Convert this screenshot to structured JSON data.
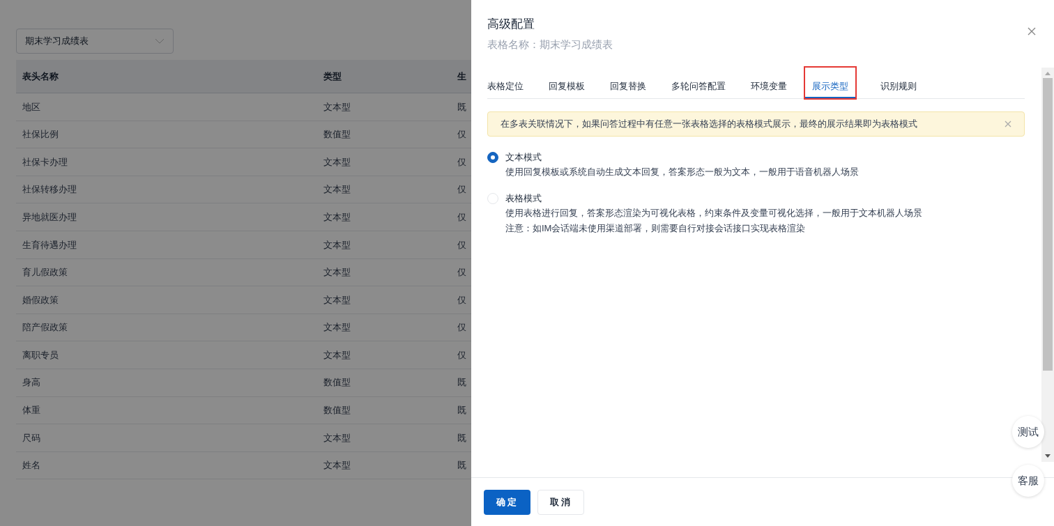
{
  "background": {
    "select": {
      "value": "期末学习成绩表"
    },
    "table": {
      "columns": [
        "表头名称",
        "类型",
        "生"
      ],
      "rows": [
        [
          "地区",
          "文本型",
          "既"
        ],
        [
          "社保比例",
          "数值型",
          "仅"
        ],
        [
          "社保卡办理",
          "文本型",
          "仅"
        ],
        [
          "社保转移办理",
          "文本型",
          "仅"
        ],
        [
          "异地就医办理",
          "文本型",
          "仅"
        ],
        [
          "生育待遇办理",
          "文本型",
          "仅"
        ],
        [
          "育儿假政策",
          "文本型",
          "仅"
        ],
        [
          "婚假政策",
          "文本型",
          "仅"
        ],
        [
          "陪产假政策",
          "文本型",
          "仅"
        ],
        [
          "离职专员",
          "文本型",
          "仅"
        ],
        [
          "身高",
          "数值型",
          "既"
        ],
        [
          "体重",
          "数值型",
          "既"
        ],
        [
          "尺码",
          "文本型",
          "既"
        ],
        [
          "姓名",
          "文本型",
          "既"
        ]
      ]
    }
  },
  "drawer": {
    "title": "高级配置",
    "subtitle": "表格名称：期末学习成绩表",
    "tabs": [
      {
        "label": "表格定位",
        "selected": false
      },
      {
        "label": "回复模板",
        "selected": false
      },
      {
        "label": "回复替换",
        "selected": false
      },
      {
        "label": "多轮问答配置",
        "selected": false
      },
      {
        "label": "环境变量",
        "selected": false
      },
      {
        "label": "展示类型",
        "selected": true
      },
      {
        "label": "识别规则",
        "selected": false
      }
    ],
    "alert": "在多表关联情况下，如果问答过程中有任意一张表格选择的表格模式展示，最终的展示结果即为表格模式",
    "options": [
      {
        "label": "文本模式",
        "selected": true,
        "lines": [
          "使用回复模板或系统自动生成文本回复，答案形态一般为文本，一般用于语音机器人场景"
        ]
      },
      {
        "label": "表格模式",
        "selected": false,
        "lines": [
          "使用表格进行回复，答案形态渲染为可视化表格，约束条件及变量可视化选择，一般用于文本机器人场景",
          "注意：如IM会话端未使用渠道部署，则需要自行对接会话接口实现表格渲染"
        ]
      }
    ],
    "buttons": [
      "确定",
      "取消"
    ]
  },
  "floating": [
    "测试",
    "客服"
  ]
}
